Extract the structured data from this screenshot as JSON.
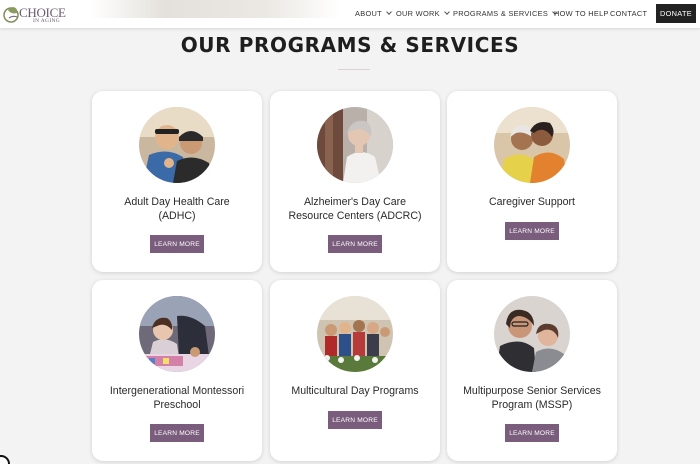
{
  "logo": {
    "text": "CHOICE",
    "subtext": "IN AGING"
  },
  "nav": {
    "items": [
      {
        "label": "ABOUT",
        "has_dropdown": true
      },
      {
        "label": "OUR WORK",
        "has_dropdown": true
      },
      {
        "label": "PROGRAMS & SERVICES",
        "has_dropdown": true
      },
      {
        "label": "HOW TO HELP",
        "has_dropdown": false
      },
      {
        "label": "CONTACT",
        "has_dropdown": false
      }
    ],
    "donate_label": "DONATE"
  },
  "page_title": "OUR PROGRAMS & SERVICES",
  "programs": [
    {
      "title": "Adult Day Health Care (ADHC)",
      "line1": "Adult Day Health Care",
      "line2": "(ADHC)",
      "button": "LEARN MORE",
      "photo": "two-smiling-men-photo"
    },
    {
      "title": "Alzheimer's Day Care Resource Centers (ADCRC)",
      "line1": "Alzheimer's Day Care",
      "line2": "Resource Centers (ADCRC)",
      "button": "LEARN MORE",
      "photo": "elderly-woman-window-photo"
    },
    {
      "title": "Caregiver Support",
      "line1": "Caregiver Support",
      "line2": "",
      "button": "LEARN MORE",
      "photo": "two-senior-women-photo"
    },
    {
      "title": "Intergenerational Montessori Preschool",
      "line1": "Intergenerational Montessori",
      "line2": "Preschool",
      "button": "LEARN MORE",
      "photo": "child-playing-photo"
    },
    {
      "title": "Multicultural Day Programs",
      "line1": "Multicultural Day Programs",
      "line2": "",
      "button": "LEARN MORE",
      "photo": "group-of-seniors-photo"
    },
    {
      "title": "Multipurpose Senior Services Program (MSSP)",
      "line1": "Multipurpose Senior Services",
      "line2": "Program (MSSP)",
      "button": "LEARN MORE",
      "photo": "two-women-smiling-photo"
    }
  ],
  "colors": {
    "accent": "#7a5c7c",
    "donate_bg": "#222222",
    "page_bg": "#f4f3f4"
  }
}
